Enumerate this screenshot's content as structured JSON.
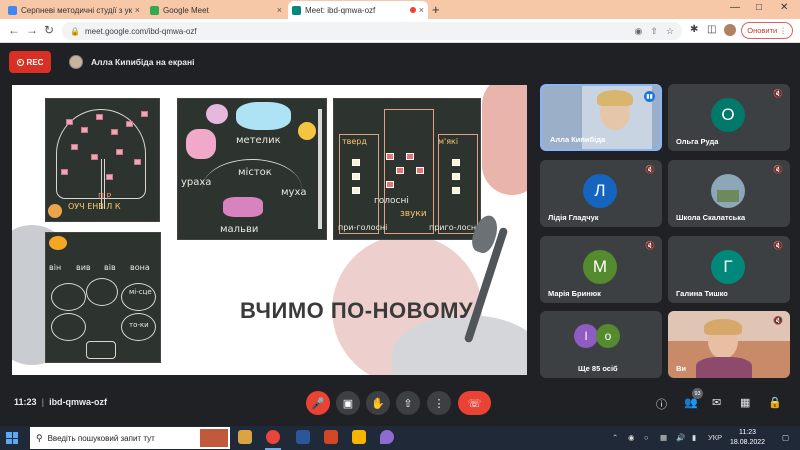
{
  "browser": {
    "tabs": [
      {
        "title": "Серпневі методичні студії з укр",
        "close": "×",
        "color": "#4285f4"
      },
      {
        "title": "Google Meet",
        "close": "×",
        "color": "#34a853"
      },
      {
        "title": "Meet: ibd-qmwa-ozf",
        "close": "×",
        "color": "#00897b"
      }
    ],
    "new_tab": "+",
    "url": "meet.google.com/ibd-qmwa-ozf",
    "update_label": "Оновити"
  },
  "meet": {
    "rec_label": "REC",
    "presenting_text": "Алла Кипибіда на екрані",
    "time": "11:23",
    "meeting_code": "ibd-qmwa-ozf",
    "participants_count": "93"
  },
  "slide": {
    "title": "ВЧИМО ПО-НОВОМУ",
    "chalk": {
      "metelyk": "метелик",
      "mistok": "місток",
      "mukha": "муха",
      "malvy": "мальви",
      "rakha": "ураха",
      "holosni": "голосні",
      "zvuky": "звуки",
      "pryholosni1": "при-голосні",
      "pryholosni2": "приго-лосні",
      "tverd": "тверд",
      "miakt": "м'які",
      "vin": "він",
      "vyv": "вив",
      "viv": "вів",
      "vona": "вона",
      "ma": "мі-сце",
      "toky": "то-ки",
      "letters": "ОУЧ ЕНВ Л К",
      "pr": "П Р"
    }
  },
  "tiles": [
    {
      "name": "Алла Кипибіда",
      "initial": "",
      "color": "#b0c4de"
    },
    {
      "name": "Ольга Руда",
      "initial": "О",
      "color": "#00796b"
    },
    {
      "name": "Лідія Гладчук",
      "initial": "Л",
      "color": "#1565c0"
    },
    {
      "name": "Школа Скалатська",
      "initial": "",
      "color": "#6d8a5c"
    },
    {
      "name": "Марія Бринюк",
      "initial": "М",
      "color": "#558b2f"
    },
    {
      "name": "Галина Тишко",
      "initial": "Г",
      "color": "#00897b"
    },
    {
      "name": "Ще 85 осіб",
      "initial": "",
      "color": "#3c4043"
    },
    {
      "name": "Ви",
      "initial": "",
      "color": "#c98a6a"
    }
  ],
  "more_initials": [
    "І",
    "о"
  ],
  "taskbar": {
    "search_placeholder": "Введіть пошуковий запит тут",
    "lang": "УКР",
    "clock_time": "11:23",
    "clock_date": "18.08.2022"
  },
  "colors": {
    "accent": "#1a73e8",
    "danger": "#ea4335",
    "tile_bg": "#3c4043",
    "meet_bg": "#202124"
  }
}
